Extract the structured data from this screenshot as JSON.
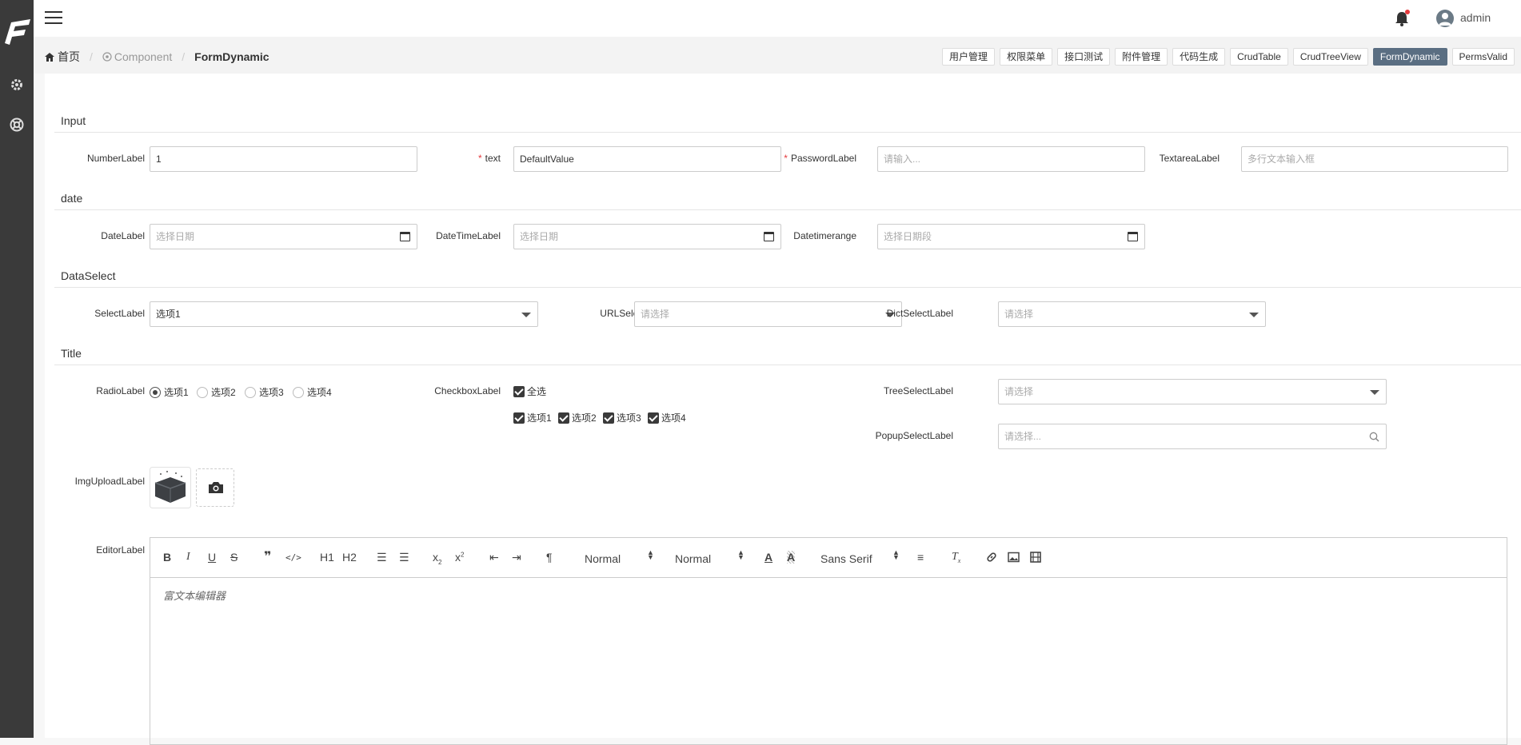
{
  "header": {
    "user": "admin"
  },
  "breadcrumb": {
    "home": "首页",
    "parent": "Component",
    "current": "FormDynamic"
  },
  "tabs": [
    "用户管理",
    "权限菜单",
    "接口测试",
    "附件管理",
    "代码生成",
    "CrudTable",
    "CrudTreeView",
    "FormDynamic",
    "PermsValid"
  ],
  "active_tab": "FormDynamic",
  "sections": {
    "input": "Input",
    "date": "date",
    "data_select": "DataSelect",
    "title": "Title"
  },
  "fields": {
    "number": {
      "label": "NumberLabel",
      "value": "1"
    },
    "text": {
      "label": "text",
      "value": "DefaultValue",
      "required": true
    },
    "password": {
      "label": "PasswordLabel",
      "placeholder": "请输入...",
      "required": true
    },
    "textarea": {
      "label": "TextareaLabel",
      "placeholder": "多行文本输入框"
    },
    "date": {
      "label": "DateLabel",
      "placeholder": "选择日期"
    },
    "datetime": {
      "label": "DateTimeLabel",
      "placeholder": "选择日期"
    },
    "daterange": {
      "label": "Datetimerange",
      "placeholder": "选择日期段"
    },
    "select": {
      "label": "SelectLabel",
      "value": "选项1"
    },
    "url_select": {
      "label": "URLSelectLabel",
      "placeholder": "请选择"
    },
    "dict_select": {
      "label": "DictSelectLabel",
      "placeholder": "请选择"
    },
    "radio": {
      "label": "RadioLabel",
      "options": [
        "选项1",
        "选项2",
        "选项3",
        "选项4"
      ],
      "selected": "选项1"
    },
    "checkbox": {
      "label": "CheckboxLabel",
      "all": "全选",
      "options": [
        "选项1",
        "选项2",
        "选项3",
        "选项4"
      ]
    },
    "tree_select": {
      "label": "TreeSelectLabel",
      "placeholder": "请选择"
    },
    "popup_select": {
      "label": "PopupSelectLabel",
      "placeholder": "请选择..."
    },
    "img_upload": {
      "label": "ImgUploadLabel"
    },
    "editor": {
      "label": "EditorLabel",
      "placeholder": "富文本编辑器",
      "header_select": "Normal",
      "size_select": "Normal",
      "font_select": "Sans Serif",
      "h1": "H1",
      "h2": "H2"
    }
  },
  "colors": {
    "sidebar": "#3a3a3a",
    "active_tab": "#5a6e82",
    "required": "#e4393c",
    "notification_dot": "#e4393c"
  },
  "icons": [
    "hamburger-icon",
    "bell-icon",
    "user-avatar-icon",
    "home-icon",
    "component-icon",
    "gear-icon",
    "help-icon",
    "calendar-icon",
    "search-icon",
    "camera-icon"
  ]
}
